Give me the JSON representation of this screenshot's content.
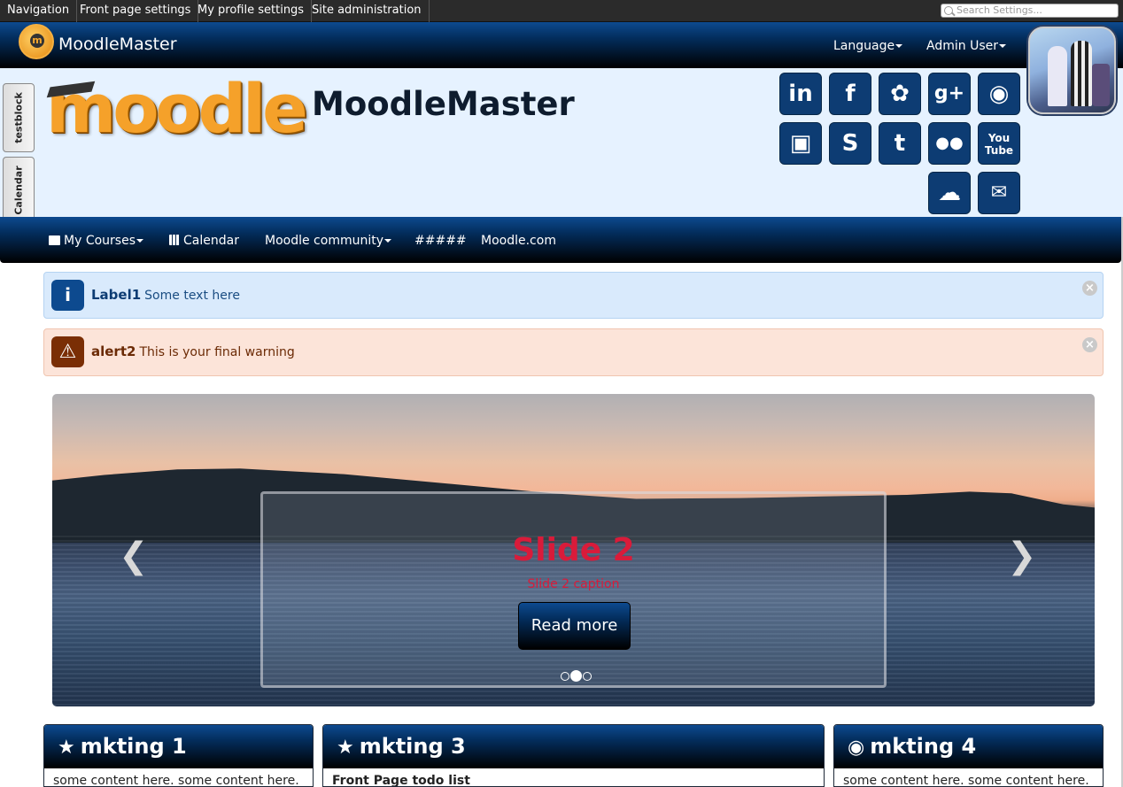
{
  "adminbar": {
    "tabs": [
      "Navigation",
      "Front page settings",
      "My profile settings",
      "Site administration"
    ],
    "search_placeholder": "Search Settings..."
  },
  "navbar": {
    "brand": "MoodleMaster",
    "language": "Language",
    "user": "Admin User"
  },
  "header": {
    "logo_word": "moodle",
    "site_title": "MoodleMaster",
    "social_icons": [
      "linkedin-icon",
      "facebook-icon",
      "twitter-icon",
      "googleplus-icon",
      "globe-icon",
      "box-icon",
      "skype-icon",
      "tumblr-icon",
      "flickr-icon",
      "youtube-icon",
      "cloud-icon",
      "chat-icon"
    ]
  },
  "side_tabs": [
    "testblock",
    "Calendar"
  ],
  "mainnav": {
    "my_courses": "My Courses",
    "calendar": "Calendar",
    "community": "Moodle community",
    "hashes": "#####",
    "moodle_com": "Moodle.com"
  },
  "alerts": [
    {
      "title": "Label1",
      "message": "Some text here",
      "bg": "#d9eafc",
      "icon_color": "#0d4a8f",
      "text_color": "#1a4d82"
    },
    {
      "title": "alert2",
      "message": "This is your final warning",
      "bg": "#fce4d9",
      "icon_color": "#7a2e05",
      "text_color": "#6b2a05"
    }
  ],
  "carousel": {
    "title": "Slide 2",
    "caption": "Slide 2 caption",
    "button": "Read more",
    "active_slide": 2,
    "total_slides": 3
  },
  "panels": [
    {
      "title": "mkting 1",
      "icon": "star-icon",
      "content": "some content here. some content here."
    },
    {
      "title": "mkting 3",
      "icon": "star-icon",
      "content": "Front Page todo list"
    },
    {
      "title": "mkting 4",
      "icon": "globe-icon",
      "content": "some content here. some content here."
    }
  ]
}
